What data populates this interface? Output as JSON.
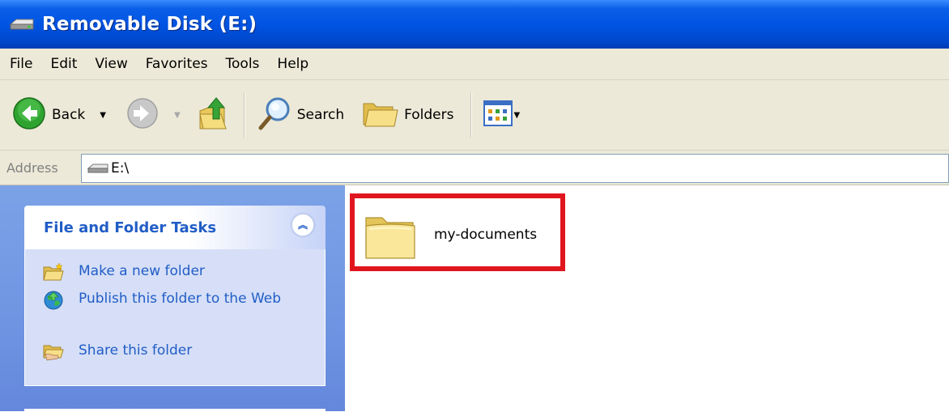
{
  "window": {
    "title": "Removable Disk (E:)",
    "icon": "drive-icon"
  },
  "menu": {
    "items": [
      "File",
      "Edit",
      "View",
      "Favorites",
      "Tools",
      "Help"
    ]
  },
  "toolbar": {
    "back_label": "Back",
    "search_label": "Search",
    "folders_label": "Folders"
  },
  "address": {
    "label": "Address",
    "value": "E:\\"
  },
  "tasks": {
    "title": "File and Folder Tasks",
    "items": [
      {
        "label": "Make a new folder",
        "icon": "new-folder-icon"
      },
      {
        "label": "Publish this folder to the Web",
        "icon": "publish-web-icon"
      },
      {
        "label": "Share this folder",
        "icon": "share-folder-icon"
      }
    ]
  },
  "content": {
    "items": [
      {
        "name": "my-documents",
        "icon": "folder-icon",
        "highlighted": true
      }
    ]
  },
  "colors": {
    "titlebar": "#0054e3",
    "taskpane": "#6f95e2",
    "task_link": "#215dc6",
    "highlight": "#e0161f"
  }
}
